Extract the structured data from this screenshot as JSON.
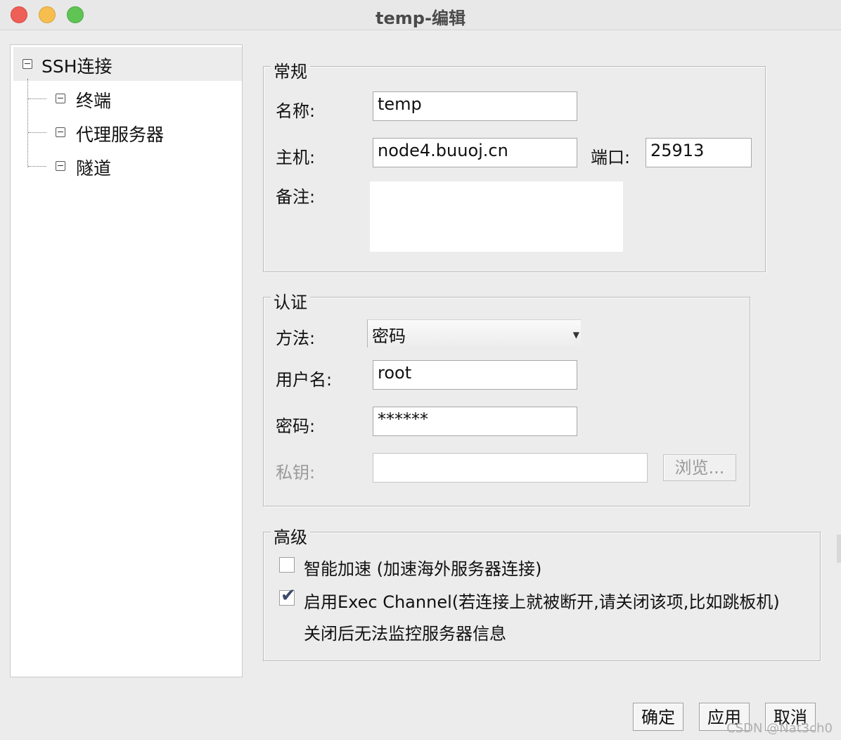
{
  "window": {
    "title": "temp-编辑"
  },
  "tree": {
    "root": "SSH连接",
    "children": [
      "终端",
      "代理服务器",
      "隧道"
    ]
  },
  "general": {
    "legend": "常规",
    "name_label": "名称:",
    "name_value": "temp",
    "host_label": "主机:",
    "host_value": "node4.buuoj.cn",
    "port_label": "端口:",
    "port_value": "25913",
    "note_label": "备注:",
    "note_value": ""
  },
  "auth": {
    "legend": "认证",
    "method_label": "方法:",
    "method_value": "密码",
    "username_label": "用户名:",
    "username_value": "root",
    "password_label": "密码:",
    "password_value": "******",
    "privkey_label": "私钥:",
    "privkey_value": "",
    "browse_label": "浏览..."
  },
  "advanced": {
    "legend": "高级",
    "smart_accel_label": "智能加速 (加速海外服务器连接)",
    "smart_accel_checked": false,
    "exec_channel_label": "启用Exec Channel(若连接上就被断开,请关闭该项,比如跳板机)",
    "exec_channel_checked": true,
    "exec_channel_note": "关闭后无法监控服务器信息"
  },
  "buttons": {
    "ok": "确定",
    "apply": "应用",
    "cancel": "取消"
  },
  "watermark": "CSDN @Nat3ch0",
  "colors": {
    "close": "#ee5f57",
    "minimize": "#f6be4f",
    "zoom": "#5fc454",
    "window_bg": "#ececec",
    "tree_selection": "#ececec",
    "checkmark": "#3b4a6b"
  }
}
